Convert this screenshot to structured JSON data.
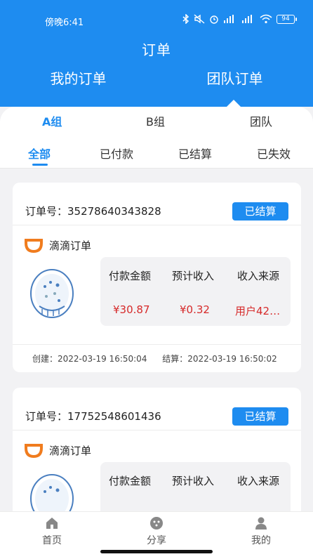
{
  "status_bar": {
    "time": "傍晚6:41",
    "battery": "94"
  },
  "header": {
    "title": "订单",
    "tabs": [
      {
        "label": "我的订单"
      },
      {
        "label": "团队订单"
      }
    ]
  },
  "group_tabs": [
    {
      "label": "A组"
    },
    {
      "label": "B组"
    },
    {
      "label": "团队"
    }
  ],
  "status_tabs": [
    {
      "label": "全部"
    },
    {
      "label": "已付款"
    },
    {
      "label": "已结算"
    },
    {
      "label": "已失效"
    }
  ],
  "orders": [
    {
      "order_label": "订单号：35278640343828",
      "status": "已结算",
      "platform": "滴滴订单",
      "labels": [
        "付款金额",
        "预计收入",
        "收入来源"
      ],
      "values": [
        "¥30.87",
        "¥0.32",
        "用户42…"
      ],
      "created": "创建：2022-03-19 16:50:04",
      "settled": "结算：2022-03-19 16:50:02"
    },
    {
      "order_label": "订单号：17752548601436",
      "status": "已结算",
      "platform": "滴滴订单",
      "labels": [
        "付款金额",
        "预计收入",
        "收入来源"
      ]
    }
  ],
  "bottom_nav": [
    {
      "label": "首页",
      "icon": "home-icon"
    },
    {
      "label": "分享",
      "icon": "share-icon"
    },
    {
      "label": "我的",
      "icon": "profile-icon"
    }
  ],
  "colors": {
    "primary": "#1e8cf0",
    "price": "#d62a2a",
    "didi_orange": "#f07c1e"
  }
}
